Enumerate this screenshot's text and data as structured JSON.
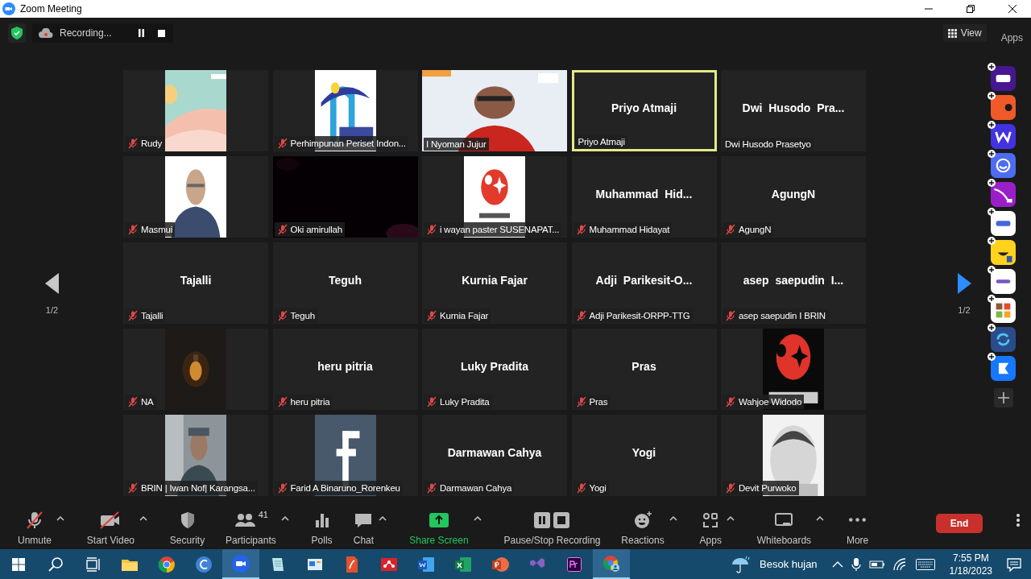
{
  "window": {
    "title": "Zoom Meeting"
  },
  "top_bar": {
    "recording_label": "Recording...",
    "view_label": "View",
    "apps_label": "Apps"
  },
  "pager": {
    "left": "1/2",
    "right": "1/2"
  },
  "tiles": [
    {
      "kind": "picture",
      "label": "Rudy",
      "muted": true,
      "speaking": false
    },
    {
      "kind": "picture",
      "label": "Perhimpunan Periset Indon...",
      "muted": true,
      "speaking": false
    },
    {
      "kind": "video",
      "label": "I Nyoman Jujur",
      "muted": false,
      "speaking": false
    },
    {
      "kind": "name",
      "display_name": "Priyo Atmaji",
      "label": "Priyo Atmaji",
      "muted": false,
      "speaking": true
    },
    {
      "kind": "name",
      "display_name": "Dwi  Husodo  Pra...",
      "label": "Dwi Husodo Prasetyo",
      "muted": false,
      "speaking": false
    },
    {
      "kind": "picture",
      "label": "Masmui",
      "muted": true,
      "speaking": false
    },
    {
      "kind": "video",
      "label": "Oki amirullah",
      "muted": true,
      "speaking": false
    },
    {
      "kind": "picture",
      "label": "i wayan paster SUSENAPAT...",
      "muted": true,
      "speaking": false
    },
    {
      "kind": "name",
      "display_name": "Muhammad  Hid...",
      "label": "Muhammad Hidayat",
      "muted": true,
      "speaking": false
    },
    {
      "kind": "name",
      "display_name": "AgungN",
      "label": "AgungN",
      "muted": true,
      "speaking": false
    },
    {
      "kind": "name",
      "display_name": "Tajalli",
      "label": "Tajalli",
      "muted": true,
      "speaking": false
    },
    {
      "kind": "name",
      "display_name": "Teguh",
      "label": "Teguh",
      "muted": true,
      "speaking": false
    },
    {
      "kind": "name",
      "display_name": "Kurnia Fajar",
      "label": "Kurnia Fajar",
      "muted": true,
      "speaking": false
    },
    {
      "kind": "name",
      "display_name": "Adji  Parikesit-O...",
      "label": "Adji Parikesit-ORPP-TTG",
      "muted": true,
      "speaking": false
    },
    {
      "kind": "name",
      "display_name": "asep  saepudin  I...",
      "label": "asep saepudin I BRIN",
      "muted": true,
      "speaking": false
    },
    {
      "kind": "picture",
      "label": "NA",
      "muted": true,
      "speaking": false
    },
    {
      "kind": "name",
      "display_name": "heru pitria",
      "label": "heru pitria",
      "muted": true,
      "speaking": false
    },
    {
      "kind": "name",
      "display_name": "Luky Pradita",
      "label": "Luky Pradita",
      "muted": true,
      "speaking": false
    },
    {
      "kind": "name",
      "display_name": "Pras",
      "label": "Pras",
      "muted": true,
      "speaking": false
    },
    {
      "kind": "picture",
      "label": "Wahjoe Widodo",
      "muted": true,
      "speaking": false
    },
    {
      "kind": "picture",
      "label": "BRIN | Iwan Nof| Karangsa...",
      "muted": true,
      "speaking": false
    },
    {
      "kind": "picture",
      "label": "Farid A Binaruno_Rorenkeu",
      "muted": true,
      "speaking": false
    },
    {
      "kind": "name",
      "display_name": "Darmawan Cahya",
      "label": "Darmawan Cahya",
      "muted": true,
      "speaking": false
    },
    {
      "kind": "name",
      "display_name": "Yogi",
      "label": "Yogi",
      "muted": true,
      "speaking": false
    },
    {
      "kind": "picture",
      "label": "Devit Purwoko",
      "muted": true,
      "speaking": false
    }
  ],
  "toolbar": [
    {
      "kind": "mic",
      "label": "Unmute",
      "caret": true
    },
    {
      "kind": "camera",
      "label": "Start Video",
      "caret": true
    },
    {
      "kind": "shield",
      "label": "Security",
      "caret": false
    },
    {
      "kind": "people",
      "label": "Participants",
      "count": "41",
      "caret": true
    },
    {
      "kind": "polls",
      "label": "Polls",
      "caret": false
    },
    {
      "kind": "chat",
      "label": "Chat",
      "caret": true
    },
    {
      "kind": "share",
      "label": "Share Screen",
      "caret": true
    },
    {
      "kind": "record",
      "label": "Pause/Stop Recording",
      "caret": false
    },
    {
      "kind": "reactions",
      "label": "Reactions",
      "caret": true
    },
    {
      "kind": "apps",
      "label": "Apps",
      "caret": true
    },
    {
      "kind": "whiteboard",
      "label": "Whiteboards",
      "caret": true
    },
    {
      "kind": "more",
      "label": "More",
      "caret": false
    }
  ],
  "end_button": "End",
  "taskbar": {
    "apps": [
      {
        "kind": "start",
        "selected": false
      },
      {
        "kind": "search",
        "selected": false
      },
      {
        "kind": "taskview",
        "selected": false
      },
      {
        "kind": "folder",
        "selected": false
      },
      {
        "kind": "chrome",
        "selected": false
      },
      {
        "kind": "canva",
        "selected": false
      },
      {
        "kind": "zoom",
        "selected": true
      },
      {
        "kind": "notepad",
        "selected": false
      },
      {
        "kind": "slides",
        "selected": false
      },
      {
        "kind": "pdf",
        "selected": false
      },
      {
        "kind": "mendeley",
        "selected": false
      },
      {
        "kind": "word",
        "selected": false
      },
      {
        "kind": "excel",
        "selected": false
      },
      {
        "kind": "powerpoint",
        "selected": false
      },
      {
        "kind": "studio",
        "selected": false
      },
      {
        "kind": "premiere",
        "selected": false
      },
      {
        "kind": "chromeprofile",
        "selected": true
      }
    ],
    "weather": "Besok hujan",
    "time": "7:55 PM",
    "date": "1/18/2023"
  }
}
